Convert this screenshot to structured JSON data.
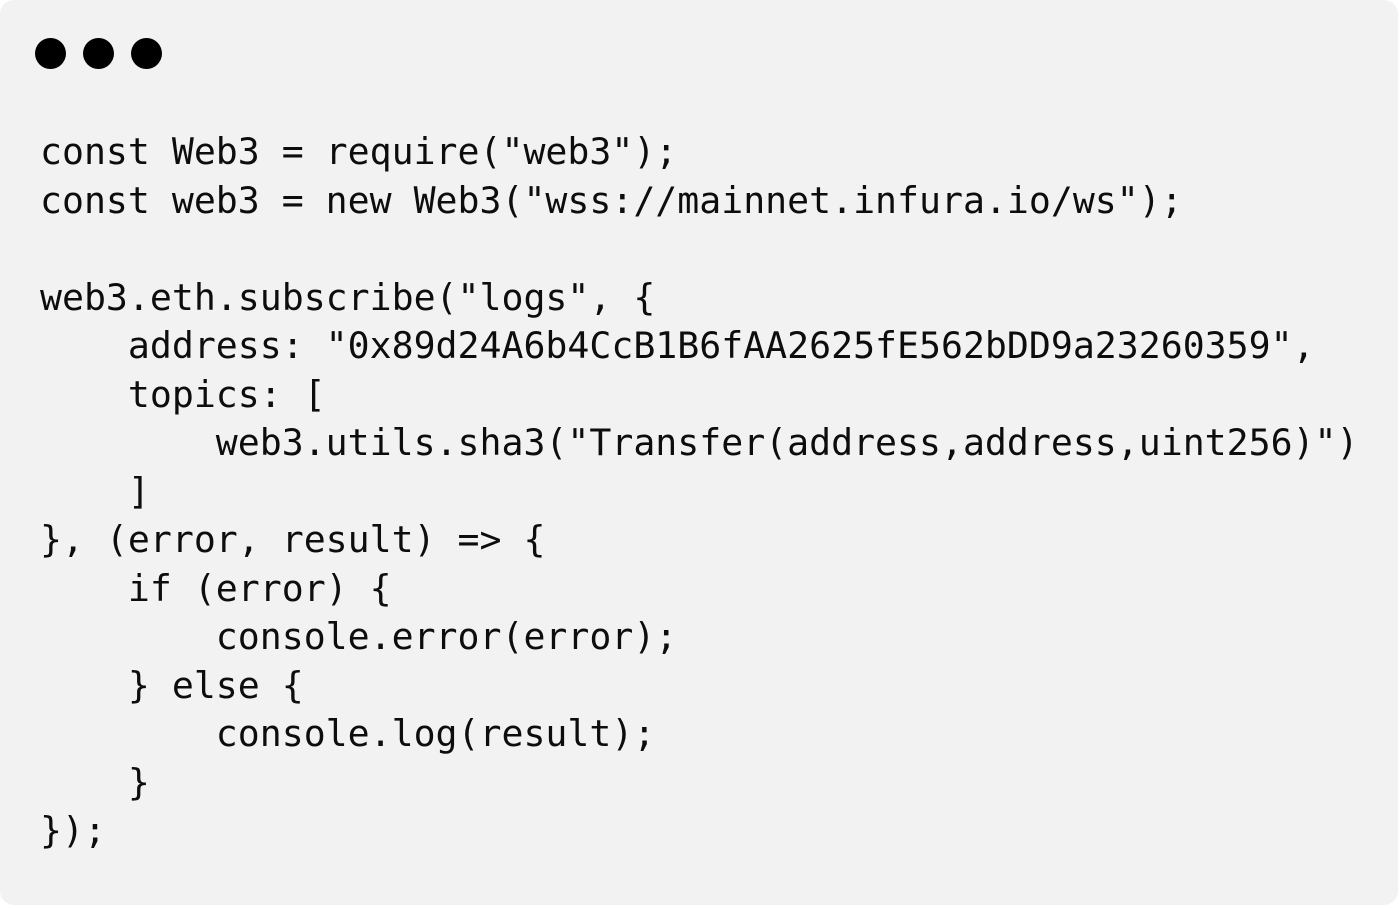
{
  "window": {
    "controls": [
      "window-dot",
      "window-dot",
      "window-dot"
    ]
  },
  "code": {
    "lines": [
      "const Web3 = require(\"web3\");",
      "const web3 = new Web3(\"wss://mainnet.infura.io/ws\");",
      "",
      "web3.eth.subscribe(\"logs\", {",
      "    address: \"0x89d24A6b4CcB1B6fAA2625fE562bDD9a23260359\",",
      "    topics: [",
      "        web3.utils.sha3(\"Transfer(address,address,uint256)\")",
      "    ]",
      "}, (error, result) => {",
      "    if (error) {",
      "        console.error(error);",
      "    } else {",
      "        console.log(result);",
      "    }",
      "});"
    ]
  }
}
